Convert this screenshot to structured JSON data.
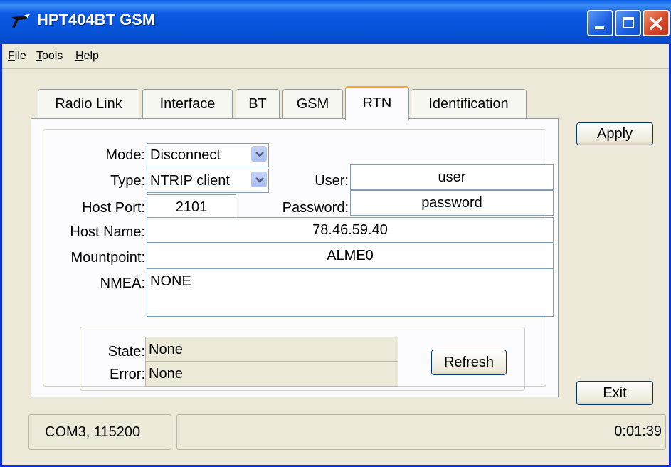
{
  "window": {
    "title": "HPT404BT GSM"
  },
  "menu": [
    {
      "label_ul": "F",
      "label_rest": "ile"
    },
    {
      "label_ul": "T",
      "label_rest": "ools"
    },
    {
      "label_ul": "H",
      "label_rest": "elp"
    }
  ],
  "tabs": [
    "Radio Link",
    "Interface",
    "BT",
    "GSM",
    "RTN",
    "Identification"
  ],
  "active_tab": "RTN",
  "form": {
    "mode_label": "Mode:",
    "mode_value": "Disconnect",
    "type_label": "Type:",
    "type_value": "NTRIP client",
    "user_label": "User:",
    "user_value": "user",
    "host_port_label": "Host Port:",
    "host_port_value": "2101",
    "password_label": "Password:",
    "password_value": "password",
    "host_name_label": "Host Name:",
    "host_name_value": "78.46.59.40",
    "mountpoint_label": "Mountpoint:",
    "mountpoint_value": "ALME0",
    "nmea_label": "NMEA:",
    "nmea_value": "NONE"
  },
  "status_group": {
    "state_label": "State:",
    "state_value": "None",
    "error_label": "Error:",
    "error_value": "None",
    "refresh_label": "Refresh"
  },
  "buttons": {
    "apply": "Apply",
    "exit": "Exit"
  },
  "statusbar": {
    "port": "COM3, 115200",
    "middle": "",
    "time": "0:01:39"
  },
  "colors": {
    "titlebar": "#0653d8",
    "active_tab_accent": "#f5a623",
    "close_button": "#d6472a"
  }
}
